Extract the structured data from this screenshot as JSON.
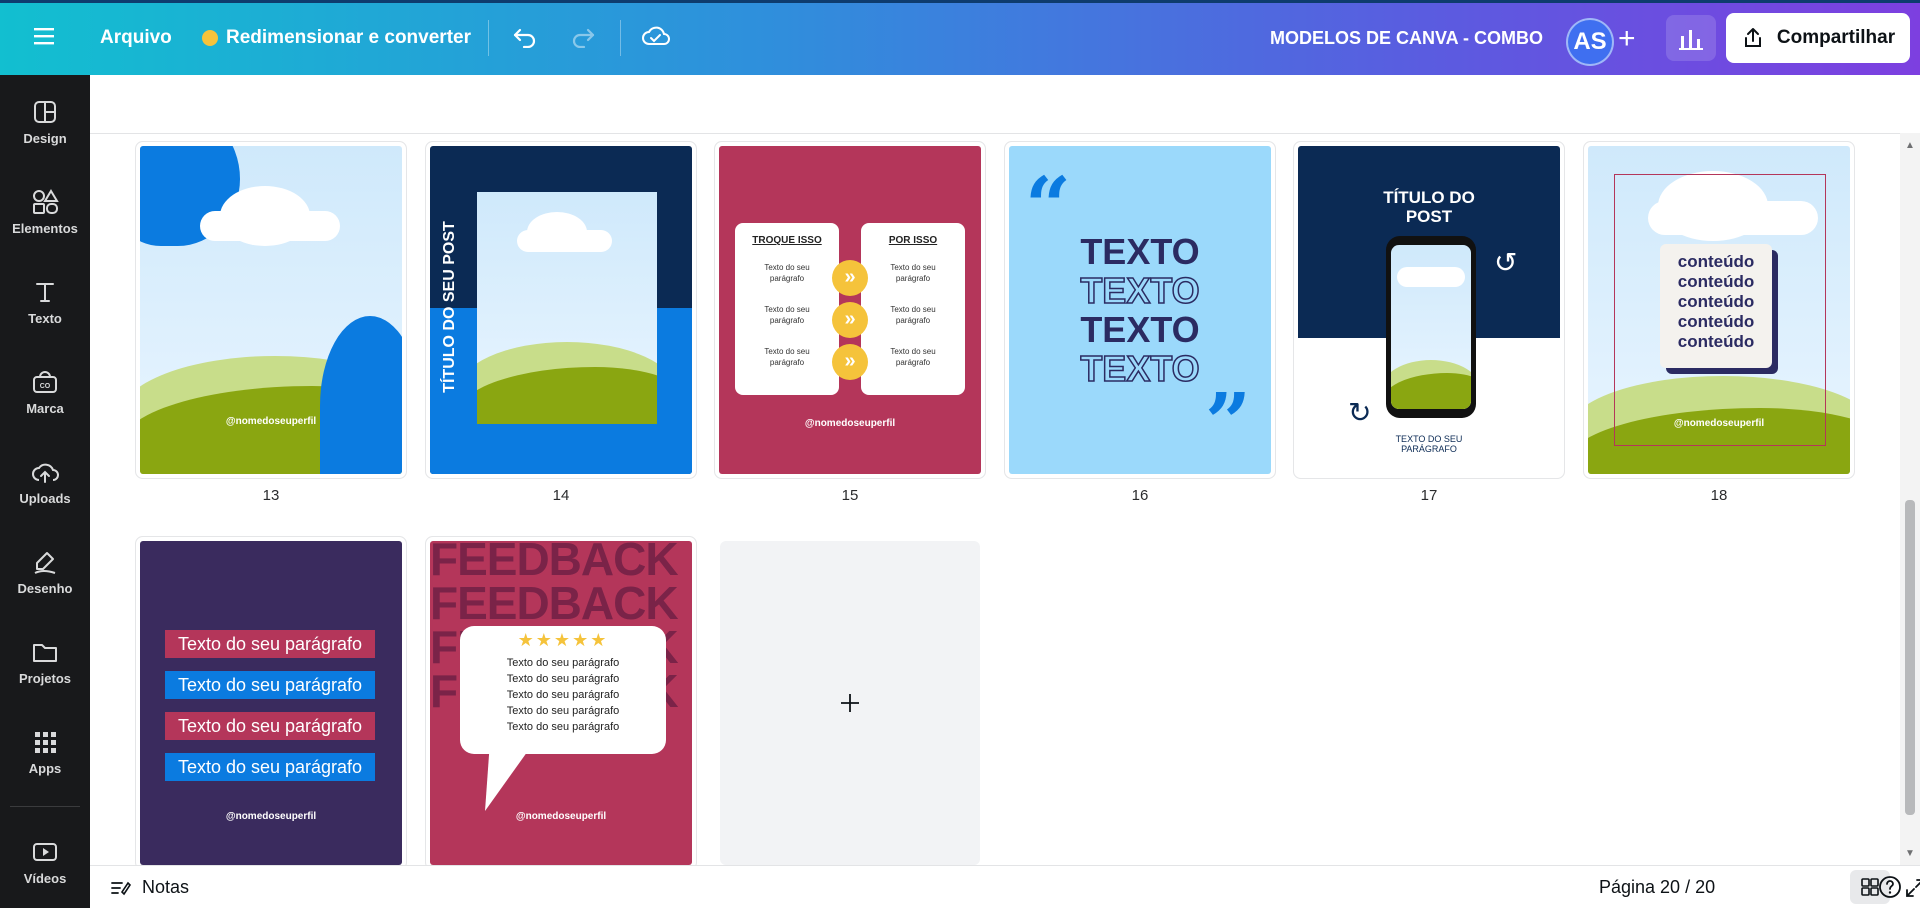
{
  "topbar": {
    "menu_icon": "hamburger-menu-icon",
    "file_label": "Arquivo",
    "resize_label": "Redimensionar e converter",
    "project_title": "MODELOS DE CANVA - COMBO",
    "avatar_initials": "AS",
    "share_label": "Compartilhar",
    "colors": {
      "gradient_start": "#12bfd0",
      "gradient_end": "#7d3fe0"
    }
  },
  "sidebar": {
    "items": [
      {
        "label": "Design",
        "icon": "design-icon"
      },
      {
        "label": "Elementos",
        "icon": "elements-icon"
      },
      {
        "label": "Texto",
        "icon": "text-icon"
      },
      {
        "label": "Marca",
        "icon": "brand-icon"
      },
      {
        "label": "Uploads",
        "icon": "upload-icon"
      },
      {
        "label": "Desenho",
        "icon": "draw-icon"
      },
      {
        "label": "Projetos",
        "icon": "folder-icon"
      },
      {
        "label": "Apps",
        "icon": "apps-icon"
      },
      {
        "label": "Vídeos",
        "icon": "video-icon"
      }
    ]
  },
  "pages": {
    "p13": {
      "number": "13",
      "handle": "@nomedoseuperfil"
    },
    "p14": {
      "number": "14",
      "title": "TÍTULO DO SEU POST"
    },
    "p15": {
      "number": "15",
      "left_title": "TROQUE ISSO",
      "right_title": "POR ISSO",
      "item": "Texto do seu parágrafo",
      "handle": "@nomedoseuperfil"
    },
    "p16": {
      "number": "16",
      "word": "TEXTO"
    },
    "p17": {
      "number": "17",
      "title": "TÍTULO DO POST",
      "paragraph_line1": "TEXTO DO SEU",
      "paragraph_line2": "PARÁGRAFO"
    },
    "p18": {
      "number": "18",
      "word": "conteúdo",
      "handle": "@nomedoseuperfil"
    },
    "p19": {
      "paragraph": "Texto do seu parágrafo",
      "handle": "@nomedoseuperfil"
    },
    "p20": {
      "bg_word": "FEEDBACK",
      "stars": "★★★★★",
      "line": "Texto do seu parágrafo",
      "handle": "@nomedoseuperfil"
    }
  },
  "bottombar": {
    "notes_label": "Notas",
    "page_indicator": "Página 20 / 20"
  }
}
